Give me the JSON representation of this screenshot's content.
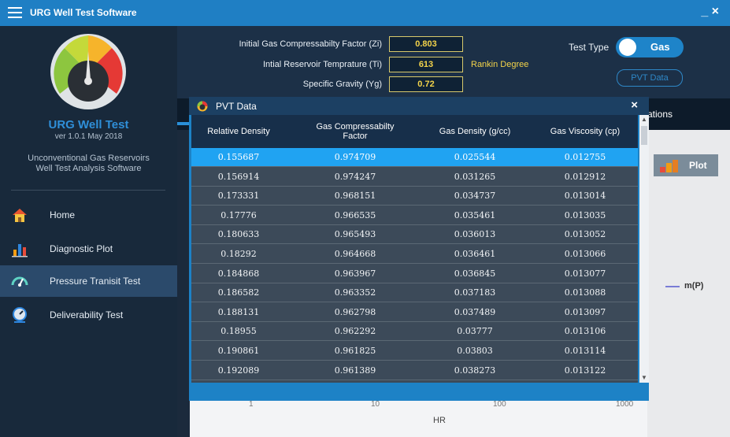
{
  "titlebar": {
    "title": "URG Well Test Software",
    "minimize": "_ ×"
  },
  "sidebar": {
    "brand": "URG Well Test",
    "version": "ver 1.0.1 May 2018",
    "tagline_1": "Unconventional Gas Reservoirs",
    "tagline_2": "Well Test Analysis Software",
    "items": [
      {
        "label": "Home",
        "icon": "home-icon"
      },
      {
        "label": "Diagnostic Plot",
        "icon": "bar-chart-icon"
      },
      {
        "label": "Pressure Tranisit Test",
        "icon": "gauge-icon",
        "active": true
      },
      {
        "label": "Deliverability Test",
        "icon": "meter-icon"
      }
    ]
  },
  "params": {
    "zi_label": "Initial Gas Compressabilty Factor (Zi)",
    "zi_value": "0.803",
    "ti_label": "Intial Reservoir Temprature (Ti)",
    "ti_value": "613",
    "ti_unit": "Rankin Degree",
    "yg_label": "Specific Gravity (Yg)",
    "yg_value": "0.72",
    "test_type_label": "Test Type",
    "test_type_value": "Gas",
    "pvt_button": "PVT Data"
  },
  "tabs": {
    "partial_label": "ations"
  },
  "chart": {
    "plot_button": "Plot",
    "legend": "m(P)",
    "xticks": [
      "1",
      "10",
      "100",
      "1000"
    ],
    "xlabel": "HR"
  },
  "dialog": {
    "title": "PVT Data",
    "close": "×",
    "columns": [
      "Relative Density",
      "Gas Compressabilty Factor",
      "Gas Density (g/cc)",
      "Gas Viscosity (cp)"
    ],
    "rows": [
      [
        "0.155687",
        "0.974709",
        "0.025544",
        "0.012755"
      ],
      [
        "0.156914",
        "0.974247",
        "0.031265",
        "0.012912"
      ],
      [
        "0.173331",
        "0.968151",
        "0.034737",
        "0.013014"
      ],
      [
        "0.17776",
        "0.966535",
        "0.035461",
        "0.013035"
      ],
      [
        "0.180633",
        "0.965493",
        "0.036013",
        "0.013052"
      ],
      [
        "0.18292",
        "0.964668",
        "0.036461",
        "0.013066"
      ],
      [
        "0.184868",
        "0.963967",
        "0.036845",
        "0.013077"
      ],
      [
        "0.186582",
        "0.963352",
        "0.037183",
        "0.013088"
      ],
      [
        "0.188131",
        "0.962798",
        "0.037489",
        "0.013097"
      ],
      [
        "0.18955",
        "0.962292",
        "0.03777",
        "0.013106"
      ],
      [
        "0.190861",
        "0.961825",
        "0.03803",
        "0.013114"
      ],
      [
        "0.192089",
        "0.961389",
        "0.038273",
        "0.013122"
      ]
    ],
    "selected_row": 0
  },
  "colors": {
    "accent": "#1f7fc4",
    "selected_row": "#20a3f2",
    "value_text": "#f3d34a"
  }
}
